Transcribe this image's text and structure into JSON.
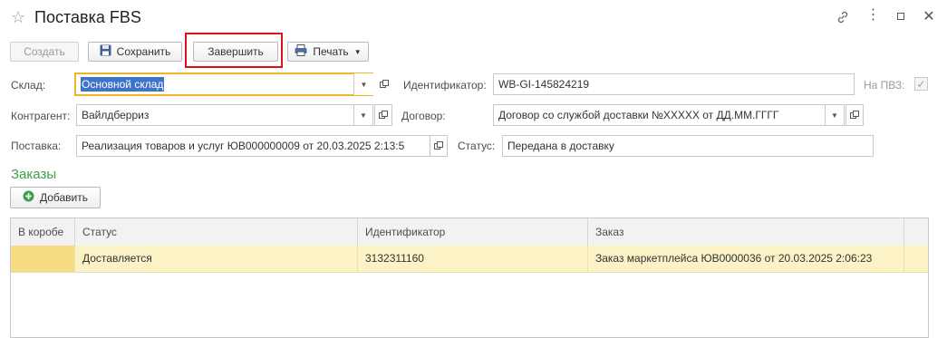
{
  "window": {
    "title": "Поставка FBS"
  },
  "toolbar": {
    "create_label": "Создать",
    "save_label": "Сохранить",
    "finish_label": "Завершить",
    "print_label": "Печать"
  },
  "form": {
    "warehouse_label": "Склад:",
    "warehouse_value": "Основной склад",
    "identifier_label": "Идентификатор:",
    "identifier_value": "WB-GI-145824219",
    "pvz_label": "На ПВЗ:",
    "pvz_checked": true,
    "counterparty_label": "Контрагент:",
    "counterparty_value": "Вайлдберриз",
    "contract_label": "Договор:",
    "contract_value": "Договор со службой доставки №XXXXX от ДД.ММ.ГГГГ",
    "supply_label": "Поставка:",
    "supply_value": "Реализация товаров и услуг ЮВ000000009 от 20.03.2025 2:13:5",
    "status_label": "Статус:",
    "status_value": "Передана в доставку"
  },
  "orders": {
    "section_title": "Заказы",
    "add_label": "Добавить",
    "columns": [
      "В коробе",
      "Статус",
      "Идентификатор",
      "Заказ"
    ],
    "rows": [
      {
        "in_box": "",
        "status": "Доставляется",
        "identifier": "3132311160",
        "order": "Заказ маркетплейса ЮВ0000036 от 20.03.2025 2:06:23"
      }
    ]
  },
  "colors": {
    "accent_green": "#3aa14b",
    "highlight_red": "#e0101b",
    "focus_yellow": "#f1b625",
    "selected_row": "#fbf2c6"
  }
}
